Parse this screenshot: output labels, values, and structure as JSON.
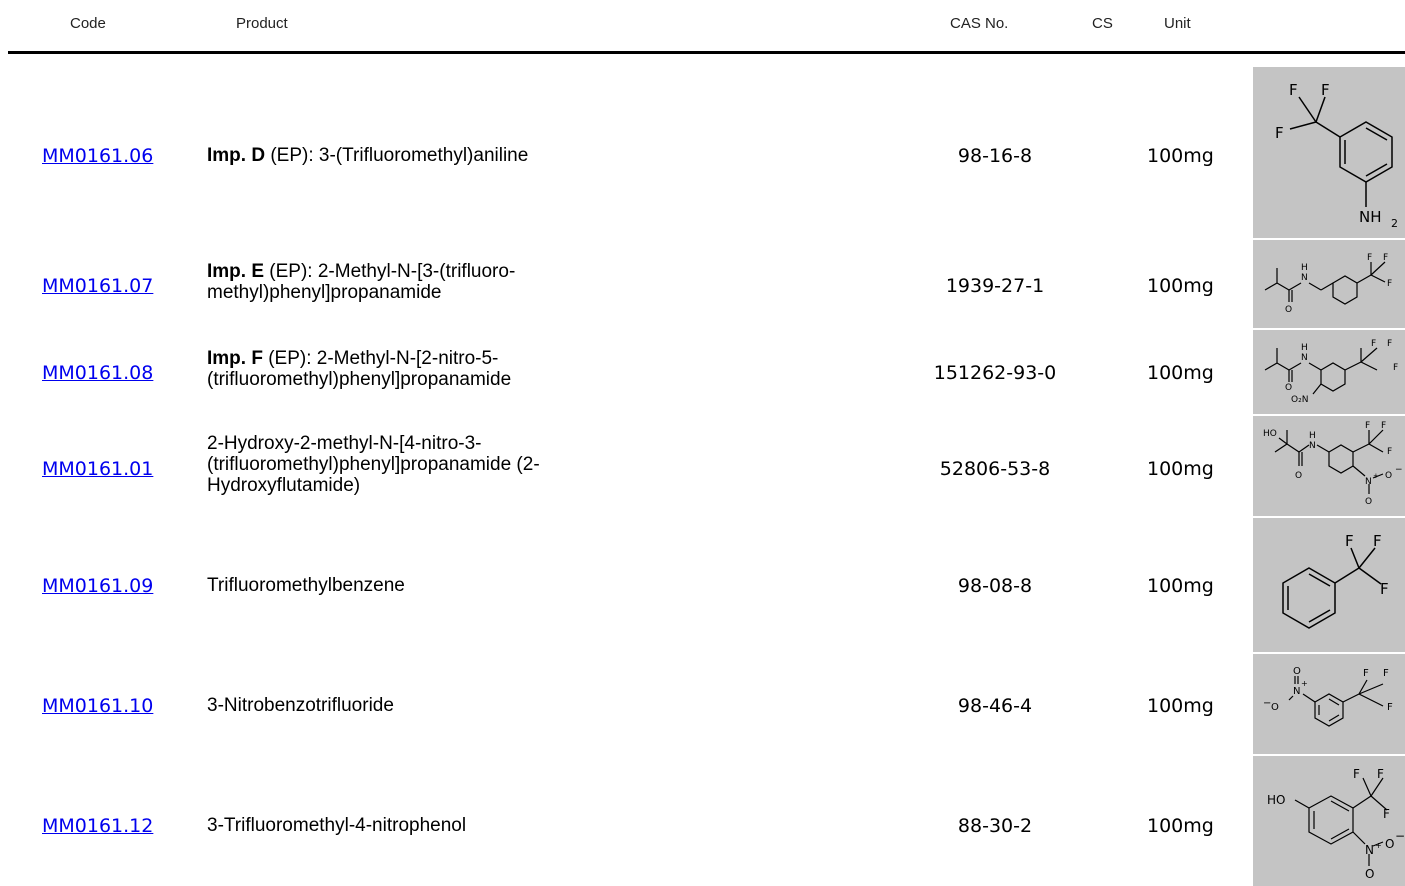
{
  "header": {
    "code": "Code",
    "product": "Product",
    "cas": "CAS No.",
    "cs": "CS",
    "unit": "Unit"
  },
  "rows": [
    {
      "code": "MM0161.06",
      "prod_bold": "Imp. D",
      "prod_text": " (EP): 3-(Trifluoromethyl)aniline",
      "cas": "98-16-8",
      "unit": "100mg",
      "structure": {
        "name": "trifluoromethyl-aniline-structure",
        "labels": [
          "F",
          "F",
          "F",
          "NH",
          "2"
        ]
      }
    },
    {
      "code": "MM0161.07",
      "prod_bold": "Imp. E",
      "prod_text": " (EP): 2-Methyl-N-[3-(trifluoro-methyl)phenyl]propanamide",
      "cas": "1939-27-1",
      "unit": "100mg",
      "structure": {
        "name": "imp-e-structure",
        "labels": [
          "H",
          "N",
          "O",
          "F",
          "F",
          "F"
        ]
      }
    },
    {
      "code": "MM0161.08",
      "prod_bold": "Imp. F",
      "prod_text": " (EP): 2-Methyl-N-[2-nitro-5-(trifluoromethyl)phenyl]propanamide",
      "cas": "151262-93-0",
      "unit": "100mg",
      "structure": {
        "name": "imp-f-structure",
        "labels": [
          "H",
          "N",
          "O",
          "O₂N",
          "F",
          "F",
          "F"
        ]
      }
    },
    {
      "code": "MM0161.01",
      "prod_bold": "",
      "prod_text": "2-Hydroxy-2-methyl-N-[4-nitro-3-(trifluoromethyl)phenyl]propanamide (2-Hydroxyflutamide)",
      "cas": "52806-53-8",
      "unit": "100mg",
      "structure": {
        "name": "hydroxyflutamide-structure",
        "labels": [
          "HO",
          "H",
          "N",
          "O",
          "F",
          "F",
          "F",
          "N",
          "+",
          "O",
          "−",
          "O"
        ]
      }
    },
    {
      "code": "MM0161.09",
      "prod_bold": "",
      "prod_text": "Trifluoromethylbenzene",
      "cas": "98-08-8",
      "unit": "100mg",
      "structure": {
        "name": "trifluoromethylbenzene-structure",
        "labels": [
          "F",
          "F",
          "F"
        ]
      }
    },
    {
      "code": "MM0161.10",
      "prod_bold": "",
      "prod_text": "3-Nitrobenzotrifluoride",
      "cas": "98-46-4",
      "unit": "100mg",
      "structure": {
        "name": "nitrobenzotrifluoride-structure",
        "labels": [
          "O",
          "N",
          "+",
          "−",
          "O",
          "F",
          "F",
          "F"
        ]
      }
    },
    {
      "code": "MM0161.12",
      "prod_bold": "",
      "prod_text": "3-Trifluoromethyl-4-nitrophenol",
      "cas": "88-30-2",
      "unit": "100mg",
      "structure": {
        "name": "trifluoromethyl-nitrophenol-structure",
        "labels": [
          "HO",
          "F",
          "F",
          "F",
          "N",
          "+",
          "O",
          "−",
          "O"
        ]
      }
    }
  ]
}
